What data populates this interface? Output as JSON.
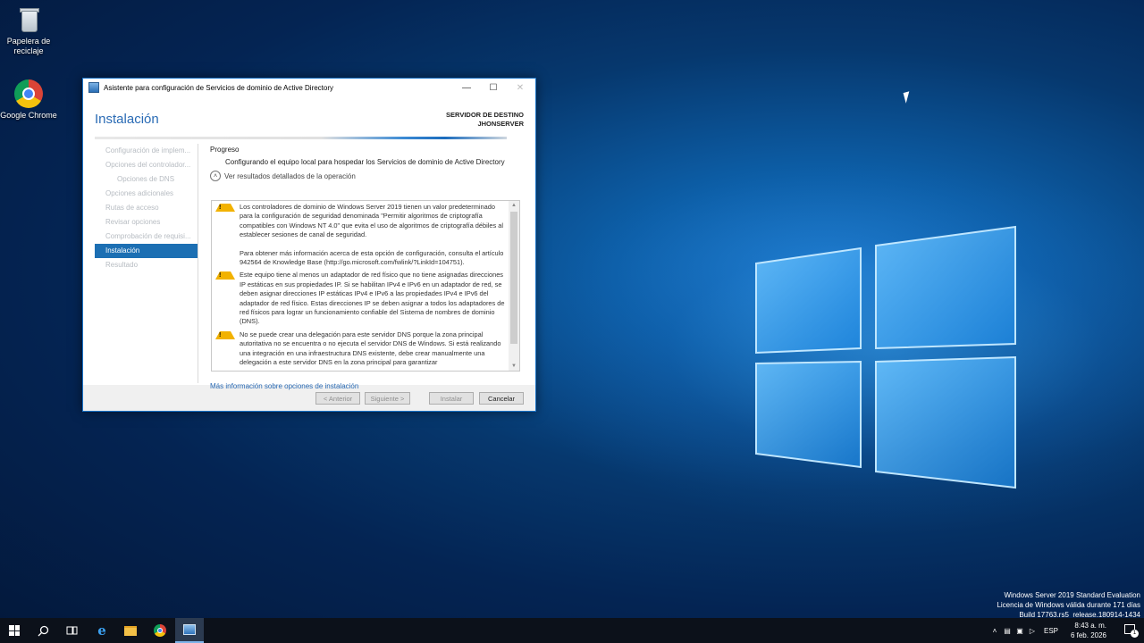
{
  "desktop": {
    "icons": [
      {
        "label": "Papelera de reciclaje",
        "icon": "recycle-bin-icon"
      },
      {
        "label": "Google Chrome",
        "icon": "chrome-icon"
      }
    ],
    "watermark": {
      "line1": "Windows Server 2019 Standard Evaluation",
      "line2": "Licencia de Windows válida durante 171 días",
      "line3": "Build 17763.rs5_release.180914-1434"
    }
  },
  "window": {
    "title": "Asistente para configuración de Servicios de dominio de Active Directory",
    "header_title": "Instalación",
    "target_label": "SERVIDOR DE DESTINO",
    "target_server": "JHONSERVER",
    "nav": [
      {
        "label": "Configuración de implem...",
        "state": "disabled"
      },
      {
        "label": "Opciones del controlador...",
        "state": "disabled"
      },
      {
        "label": "Opciones de DNS",
        "state": "disabled",
        "sub": true
      },
      {
        "label": "Opciones adicionales",
        "state": "disabled"
      },
      {
        "label": "Rutas de acceso",
        "state": "disabled"
      },
      {
        "label": "Revisar opciones",
        "state": "disabled"
      },
      {
        "label": "Comprobación de requisi...",
        "state": "disabled"
      },
      {
        "label": "Instalación",
        "state": "active"
      },
      {
        "label": "Resultado",
        "state": "disabled"
      }
    ],
    "progress_label": "Progreso",
    "progress_status": "Configurando el equipo local para hospedar los Servicios de dominio de Active Directory",
    "details_toggle": "Ver resultados detallados de la operación",
    "messages": [
      {
        "p1": "Los controladores de dominio de Windows Server 2019 tienen un valor predeterminado para la configuración de seguridad denominada \"Permitir algoritmos de criptografía compatibles con Windows NT 4.0\" que evita el uso de algoritmos de criptografía débiles al establecer sesiones de canal de seguridad.",
        "p2": "Para obtener más información acerca de esta opción de configuración, consulta el artículo 942564 de Knowledge Base (http://go.microsoft.com/fwlink/?LinkId=104751)."
      },
      {
        "p1": "Este equipo tiene al menos un adaptador de red físico que no tiene asignadas direcciones IP estáticas en sus propiedades IP. Si se habilitan IPv4 e IPv6 en un adaptador de red, se deben asignar direcciones IP estáticas IPv4 e IPv6 a las propiedades IPv4 e IPv6 del adaptador de red físico. Estas direcciones IP se deben asignar a todos los adaptadores de red físicos para lograr un funcionamiento confiable del Sistema de nombres de dominio (DNS)."
      },
      {
        "p1": "No se puede crear una delegación para este servidor DNS porque la zona principal autoritativa no se encuentra o no ejecuta el servidor DNS de Windows. Si está realizando una integración en una infraestructura DNS existente, debe crear manualmente una delegación a este servidor DNS en la zona principal para garantizar"
      }
    ],
    "more_info_link": "Más información sobre opciones de instalación",
    "buttons": {
      "back": "< Anterior",
      "next": "Siguiente >",
      "install": "Instalar",
      "cancel": "Cancelar"
    }
  },
  "taskbar": {
    "language": "ESP",
    "time": "8:43 a. m.",
    "date": "6 feb. 2026",
    "notification_count": "1"
  }
}
